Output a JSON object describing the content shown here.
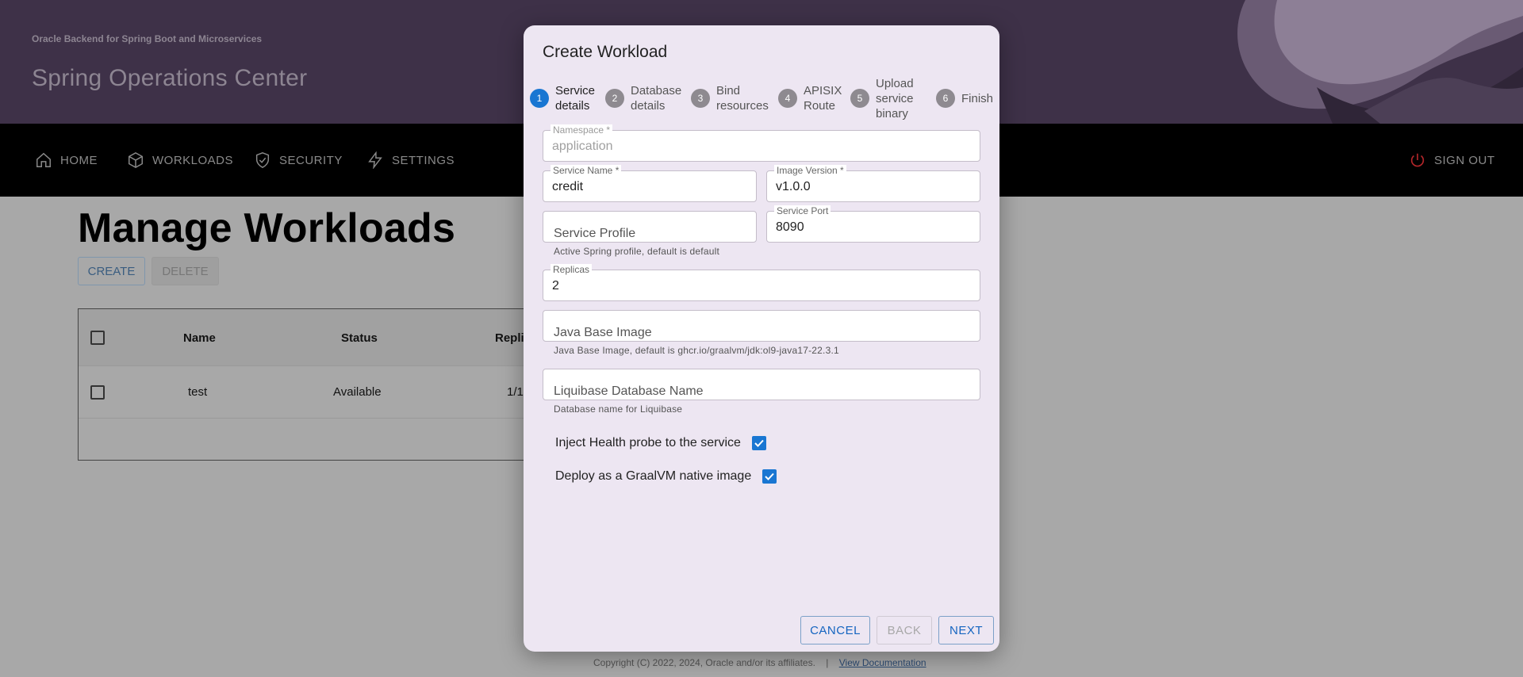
{
  "banner": {
    "subtitle": "Oracle Backend for Spring Boot and Microservices",
    "title": "Spring Operations Center"
  },
  "nav": {
    "items": [
      {
        "label": "HOME",
        "icon": "home-icon"
      },
      {
        "label": "WORKLOADS",
        "icon": "cube-icon"
      },
      {
        "label": "SECURITY",
        "icon": "shield-icon"
      },
      {
        "label": "SETTINGS",
        "icon": "lightning-icon"
      }
    ],
    "signout": "SIGN OUT",
    "signout_icon": "power-icon"
  },
  "page": {
    "title": "Manage Workloads",
    "create": "CREATE",
    "delete": "DELETE"
  },
  "table": {
    "headers": [
      "Name",
      "Status",
      "Replic"
    ],
    "rows": [
      {
        "name": "test",
        "status": "Available",
        "replicas": "1/1"
      }
    ]
  },
  "footer": {
    "copyright": "Copyright (C) 2022, 2024, Oracle and/or its affiliates.",
    "separator": "|",
    "link": "View Documentation"
  },
  "modal": {
    "title": "Create Workload",
    "steps": [
      {
        "num": "1",
        "label": "Service details",
        "active": true
      },
      {
        "num": "2",
        "label": "Database details",
        "active": false
      },
      {
        "num": "3",
        "label": "Bind resources",
        "active": false
      },
      {
        "num": "4",
        "label": "APISIX Route",
        "active": false
      },
      {
        "num": "5",
        "label": "Upload service binary",
        "active": false
      },
      {
        "num": "6",
        "label": "Finish",
        "active": false
      }
    ],
    "fields": {
      "namespace": {
        "label": "Namespace *",
        "value": "application"
      },
      "service_name": {
        "label": "Service Name *",
        "value": "credit"
      },
      "image_version": {
        "label": "Image Version *",
        "value": "v1.0.0"
      },
      "service_profile": {
        "placeholder": "Service Profile",
        "helper": "Active Spring profile, default is default"
      },
      "service_port": {
        "label": "Service Port",
        "value": "8090"
      },
      "replicas": {
        "label": "Replicas",
        "value": "2"
      },
      "java_base_image": {
        "placeholder": "Java Base Image",
        "helper": "Java Base Image, default is ghcr.io/graalvm/jdk:ol9-java17-22.3.1"
      },
      "liquibase_db": {
        "placeholder": "Liquibase Database Name",
        "helper": "Database name for Liquibase"
      }
    },
    "checks": {
      "health_probe": {
        "label": "Inject Health probe to the service",
        "checked": true
      },
      "graalvm": {
        "label": "Deploy as a GraalVM native image",
        "checked": true
      }
    },
    "buttons": {
      "cancel": "CANCEL",
      "back": "BACK",
      "next": "NEXT"
    }
  },
  "colors": {
    "banner": "#3e3148",
    "accent": "#1976d2",
    "modal_bg": "#ede6f2",
    "signout_icon": "#b3262a"
  }
}
